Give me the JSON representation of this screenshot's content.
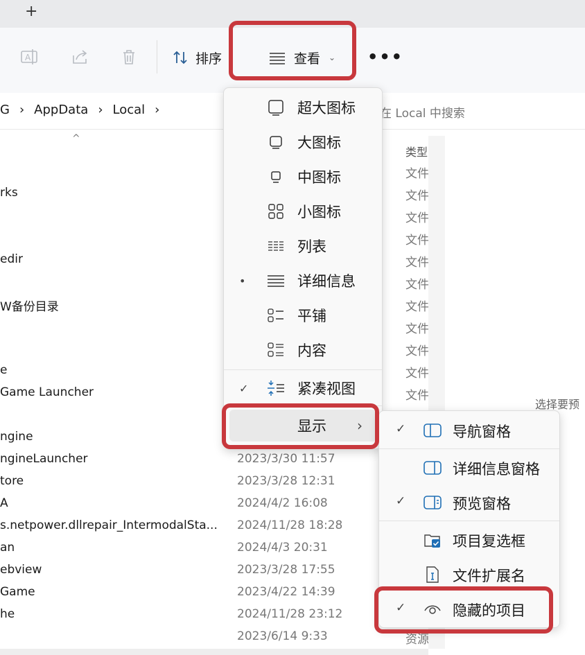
{
  "tabstrip": {
    "new_tab": "+"
  },
  "toolbar": {
    "sort_label": "排序",
    "view_label": "查看",
    "more_label": "•••"
  },
  "address": {
    "crumbs": [
      "G",
      "AppData",
      "Local"
    ],
    "search_placeholder": "在 Local 中搜索"
  },
  "columns": {
    "type_header": "类型"
  },
  "files": [
    {
      "name": "rks",
      "date": "",
      "type": "文件"
    },
    {
      "name": "edir",
      "date": "",
      "type": "文件"
    },
    {
      "name": "W备份目录",
      "date": "",
      "type": "文件"
    },
    {
      "name": "e",
      "date": "",
      "type": "文件"
    },
    {
      "name": "Game Launcher",
      "date": "",
      "type": "文件"
    },
    {
      "name": "ngine",
      "date": "",
      "type": ""
    },
    {
      "name": "ngineLauncher",
      "date": "2023/3/30 11:57",
      "type": ""
    },
    {
      "name": "tore",
      "date": "2023/3/28 12:31",
      "type": ""
    },
    {
      "name": "A",
      "date": "2024/4/2 16:08",
      "type": ""
    },
    {
      "name": "s.netpower.dllrepair_IntermodalSta...",
      "date": "2024/11/28 18:28",
      "type": ""
    },
    {
      "name": "an",
      "date": "2024/4/3 20:31",
      "type": ""
    },
    {
      "name": "ebview",
      "date": "2023/3/28 17:55",
      "type": ""
    },
    {
      "name": "Game",
      "date": "2023/4/22 14:39",
      "type": ""
    },
    {
      "name": "he",
      "date": "2024/11/28 23:12",
      "type": ""
    },
    {
      "name": "",
      "date": "2023/6/14 9:33",
      "type": "资源"
    }
  ],
  "extra_types": [
    "文件",
    "文件",
    "文件",
    "文件",
    "文件",
    "文件"
  ],
  "preview_hint": "选择要预",
  "view_menu": {
    "items": [
      {
        "label": "超大图标",
        "icon": "extra-large-icons-icon",
        "selected": false
      },
      {
        "label": "大图标",
        "icon": "large-icons-icon",
        "selected": false
      },
      {
        "label": "中图标",
        "icon": "medium-icons-icon",
        "selected": false
      },
      {
        "label": "小图标",
        "icon": "small-icons-icon",
        "selected": false
      },
      {
        "label": "列表",
        "icon": "list-icon",
        "selected": false
      },
      {
        "label": "详细信息",
        "icon": "details-icon",
        "selected": true
      },
      {
        "label": "平铺",
        "icon": "tiles-icon",
        "selected": false
      },
      {
        "label": "内容",
        "icon": "content-icon",
        "selected": false
      }
    ],
    "compact": {
      "label": "紧凑视图",
      "checked": true
    },
    "show": {
      "label": "显示",
      "arrow": "›"
    },
    "bullet": "•",
    "check": "✓"
  },
  "show_menu": {
    "items": [
      {
        "label": "导航窗格",
        "checked": true
      },
      {
        "label": "详细信息窗格",
        "checked": false
      },
      {
        "label": "预览窗格",
        "checked": true
      },
      {
        "label": "项目复选框",
        "checked": false
      },
      {
        "label": "文件扩展名",
        "checked": false
      },
      {
        "label": "隐藏的项目",
        "checked": true
      }
    ]
  },
  "colors": {
    "highlight": "#c8383d",
    "accent": "#1f6fb5"
  }
}
